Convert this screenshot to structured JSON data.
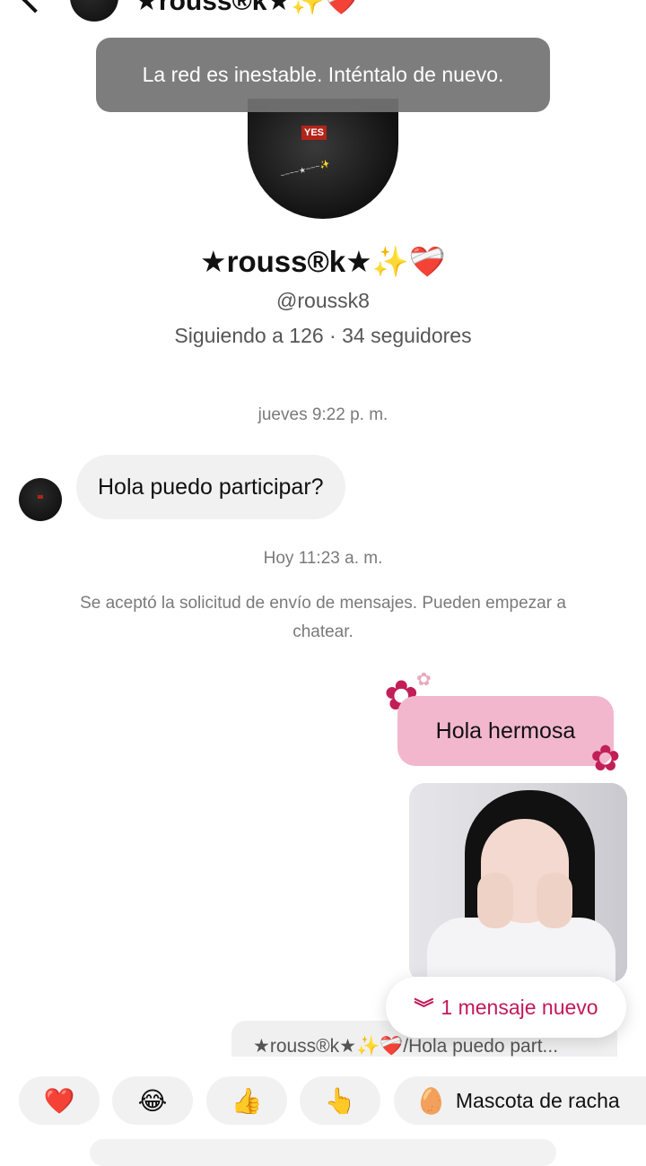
{
  "header": {
    "name": "★rouss®k★✨❤️‍🩹"
  },
  "toast": {
    "text": "La red es inestable. Inténtalo de nuevo."
  },
  "profile": {
    "name": "★rouss®k★✨❤️‍🩹",
    "handle": "@roussk8",
    "stats": "Siguiendo a 126 · 34 seguidores"
  },
  "conversation": {
    "timestamp_1": "jueves 9:22 p. m.",
    "incoming_text": "Hola puedo participar?",
    "timestamp_2": "Hoy 11:23 a. m.",
    "system_message": "Se aceptó la solicitud de envío de mensajes. Pueden empezar a chatear.",
    "outgoing_text": "Hola hermosa"
  },
  "new_messages": {
    "icon": "double-chevron-down-icon",
    "label": "1 mensaje nuevo"
  },
  "reply_preview": {
    "text": "★rouss®k★✨❤️‍🩹/Hola puedo part..."
  },
  "quick_reactions": {
    "items": [
      "❤️",
      "😂",
      "👍",
      "👆"
    ],
    "pet_icon": "🥚",
    "pet_label": "Mascota de racha"
  },
  "colors": {
    "accent": "#c2185b",
    "outgoing_bubble": "#f2b7cc",
    "incoming_bubble": "#f1f1f2",
    "toast_bg": "#737373"
  }
}
